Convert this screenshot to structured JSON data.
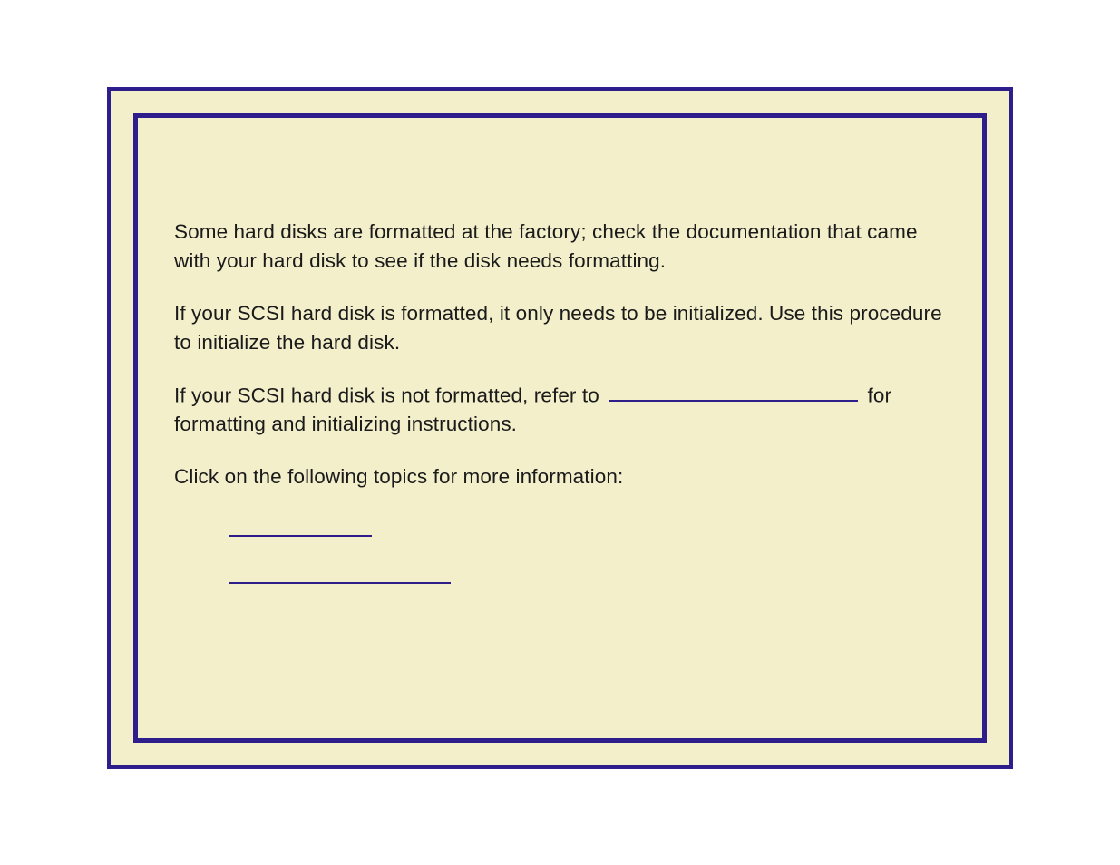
{
  "paragraphs": {
    "p1": "Some hard disks are formatted at the factory; check the documentation that came with your hard disk to see if the disk needs formatting.",
    "p2": "If your SCSI hard disk is formatted, it only needs to be initialized.  Use this procedure to initialize the hard disk.",
    "p3_pre": "If your SCSI hard disk is not formatted, refer to ",
    "p3_post": " for formatting and initializing instructions.",
    "p4": "Click on the following topics for more information:"
  }
}
